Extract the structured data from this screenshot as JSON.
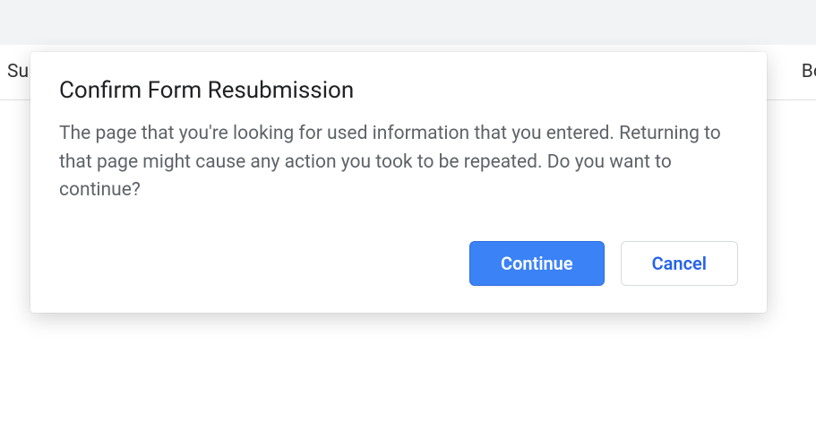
{
  "nav": {
    "left_fragment": "Su",
    "right_fragment": "Boun"
  },
  "dialog": {
    "title": "Confirm Form Resubmission",
    "body": "The page that you're looking for used information that you entered. Returning to that page might cause any action you took to be repeated. Do you want to continue?",
    "continue_label": "Continue",
    "cancel_label": "Cancel"
  }
}
